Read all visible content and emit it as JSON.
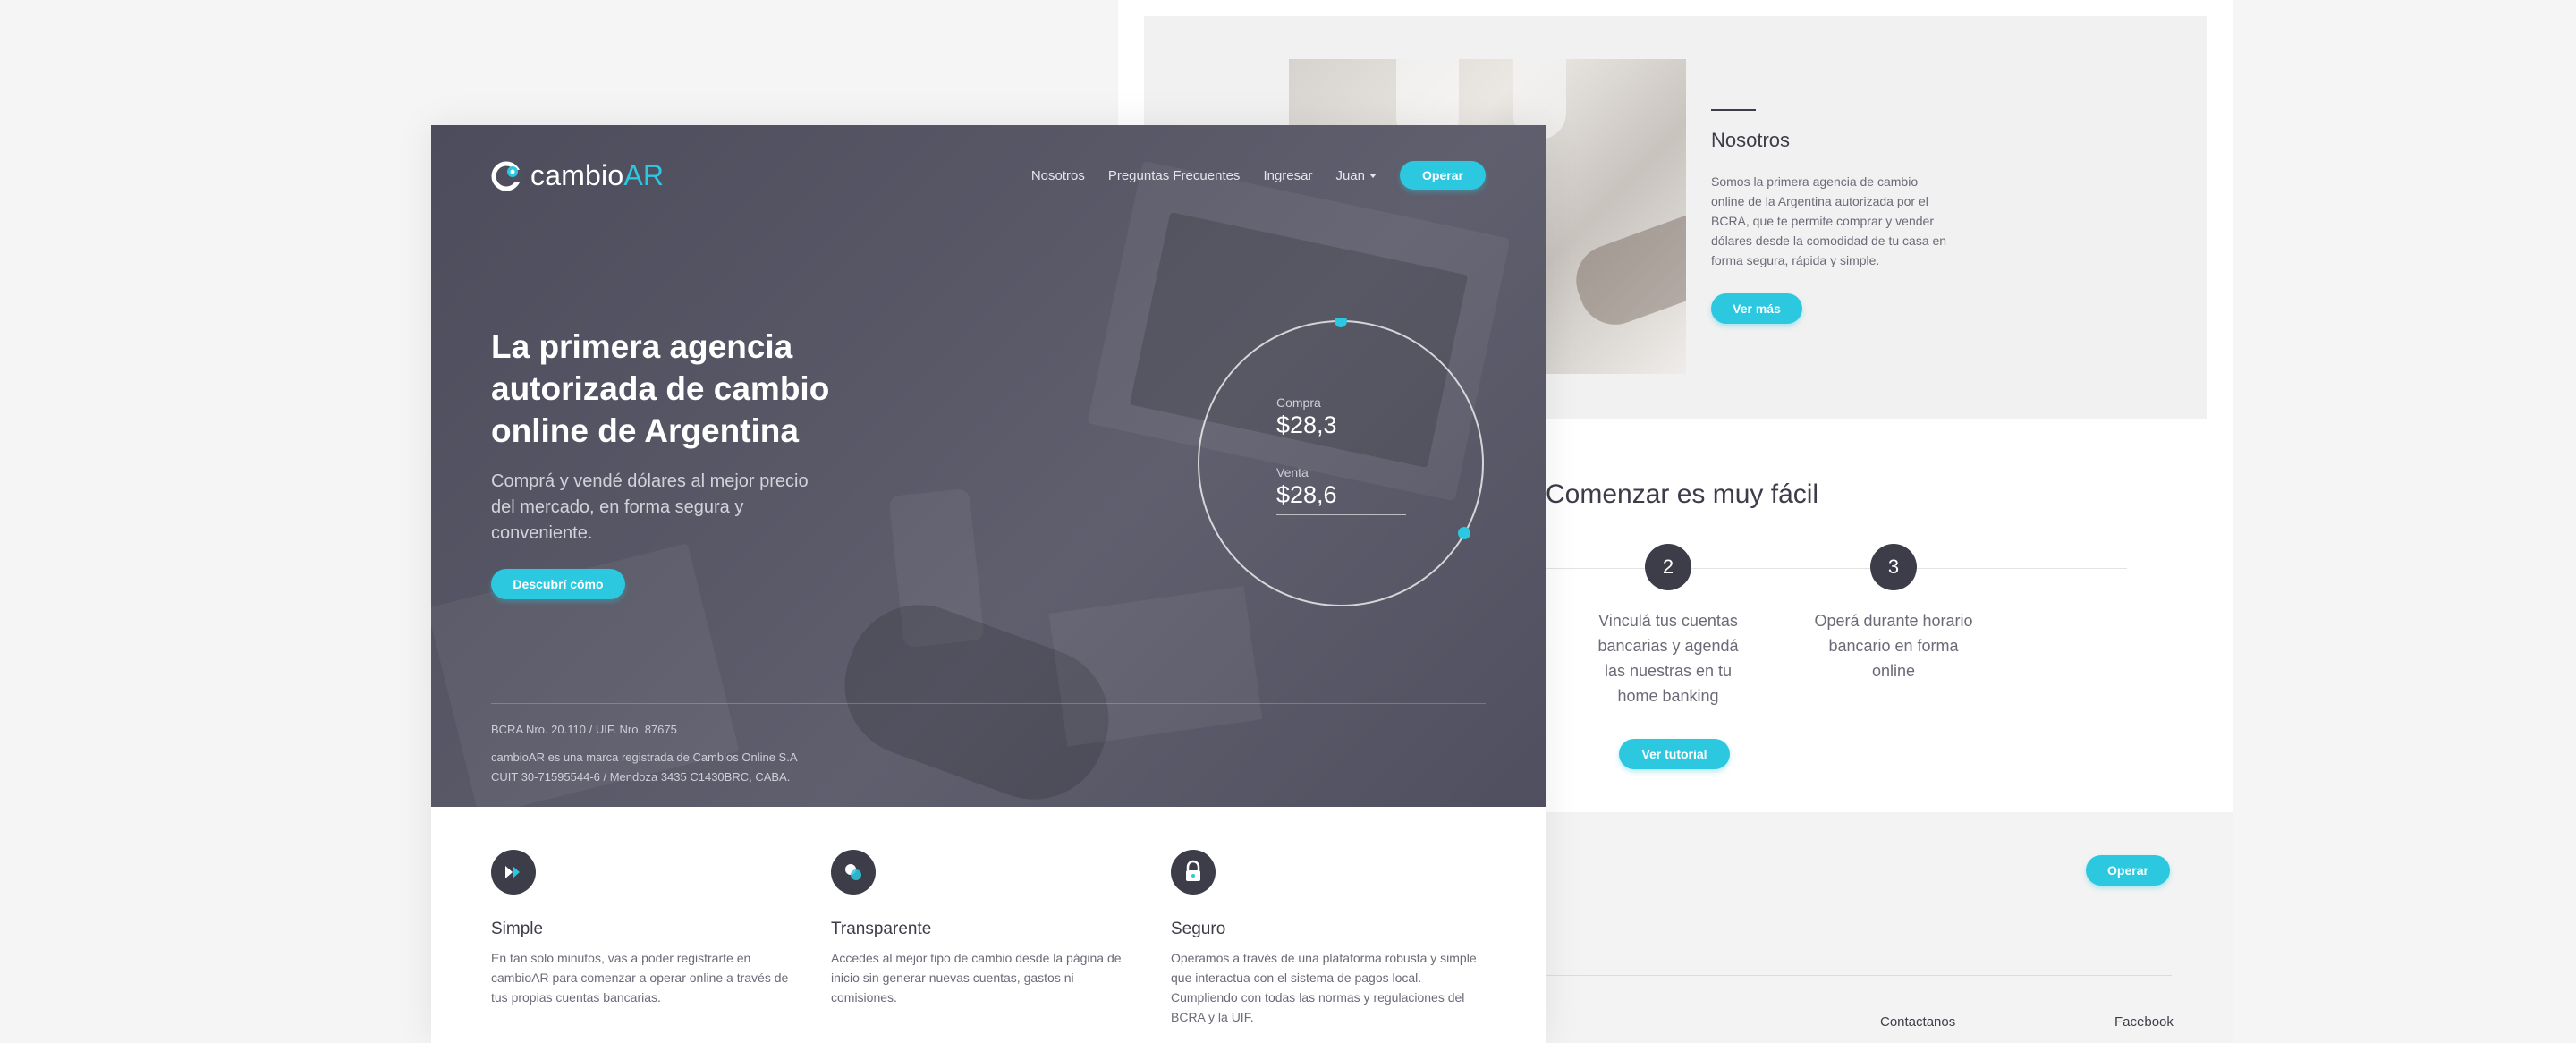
{
  "about": {
    "title": "Nosotros",
    "body": "Somos la primera agencia de cambio online de la Argentina autorizada por el BCRA, que te permite comprar y vender dólares desde la comodidad de tu casa en forma segura, rápida y simple.",
    "button": "Ver más"
  },
  "steps": {
    "title": "Comenzar es muy fácil",
    "items": [
      {
        "number": "2",
        "text": "Vinculá tus cuentas bancarias y agendá las nuestras en tu home banking"
      },
      {
        "number": "3",
        "text": "Operá durante horario bancario en forma online"
      }
    ],
    "tutorial_button": "Ver tutorial"
  },
  "footer": {
    "operar_button": "Operar",
    "contact_link": "Contactanos",
    "facebook_link": "Facebook"
  },
  "nav": {
    "logo_main": "cambio",
    "logo_accent": "AR",
    "links": [
      "Nosotros",
      "Preguntas Frecuentes",
      "Ingresar"
    ],
    "user": "Juan",
    "operar_button": "Operar"
  },
  "hero": {
    "title": "La primera agencia autorizada de cambio online de Argentina",
    "subtitle": "Comprá y vendé dólares al mejor precio del mercado, en forma segura y conveniente.",
    "button": "Descubrí cómo"
  },
  "rates": {
    "compra_label": "Compra",
    "compra_value": "$28,3",
    "venta_label": "Venta",
    "venta_value": "$28,6"
  },
  "legal": {
    "line1": "BCRA Nro. 20.110 / UIF. Nro. 87675",
    "line2": "cambioAR es una marca registrada de Cambios Online S.A",
    "line3": "CUIT 30-71595544-6 / Mendoza 3435 C1430BRC, CABA."
  },
  "features": [
    {
      "icon": "fast-forward-icon",
      "title": "Simple",
      "body": "En tan solo minutos, vas a poder registrarte en cambioAR para comenzar a operar online a través de tus propias cuentas bancarias."
    },
    {
      "icon": "transparent-circles-icon",
      "title": "Transparente",
      "body": "Accedés al mejor tipo de cambio desde la página de inicio sin generar nuevas cuentas, gastos ni comisiones."
    },
    {
      "icon": "lock-icon",
      "title": "Seguro",
      "body": "Operamos a través de una plataforma robusta y simple que interactua con el sistema de pagos local. Cumpliendo con todas las normas y regulaciones del BCRA y la UIF."
    }
  ],
  "colors": {
    "accent": "#2bc8e0",
    "dark": "#3d3d4a",
    "hero_bg": "#555564"
  }
}
